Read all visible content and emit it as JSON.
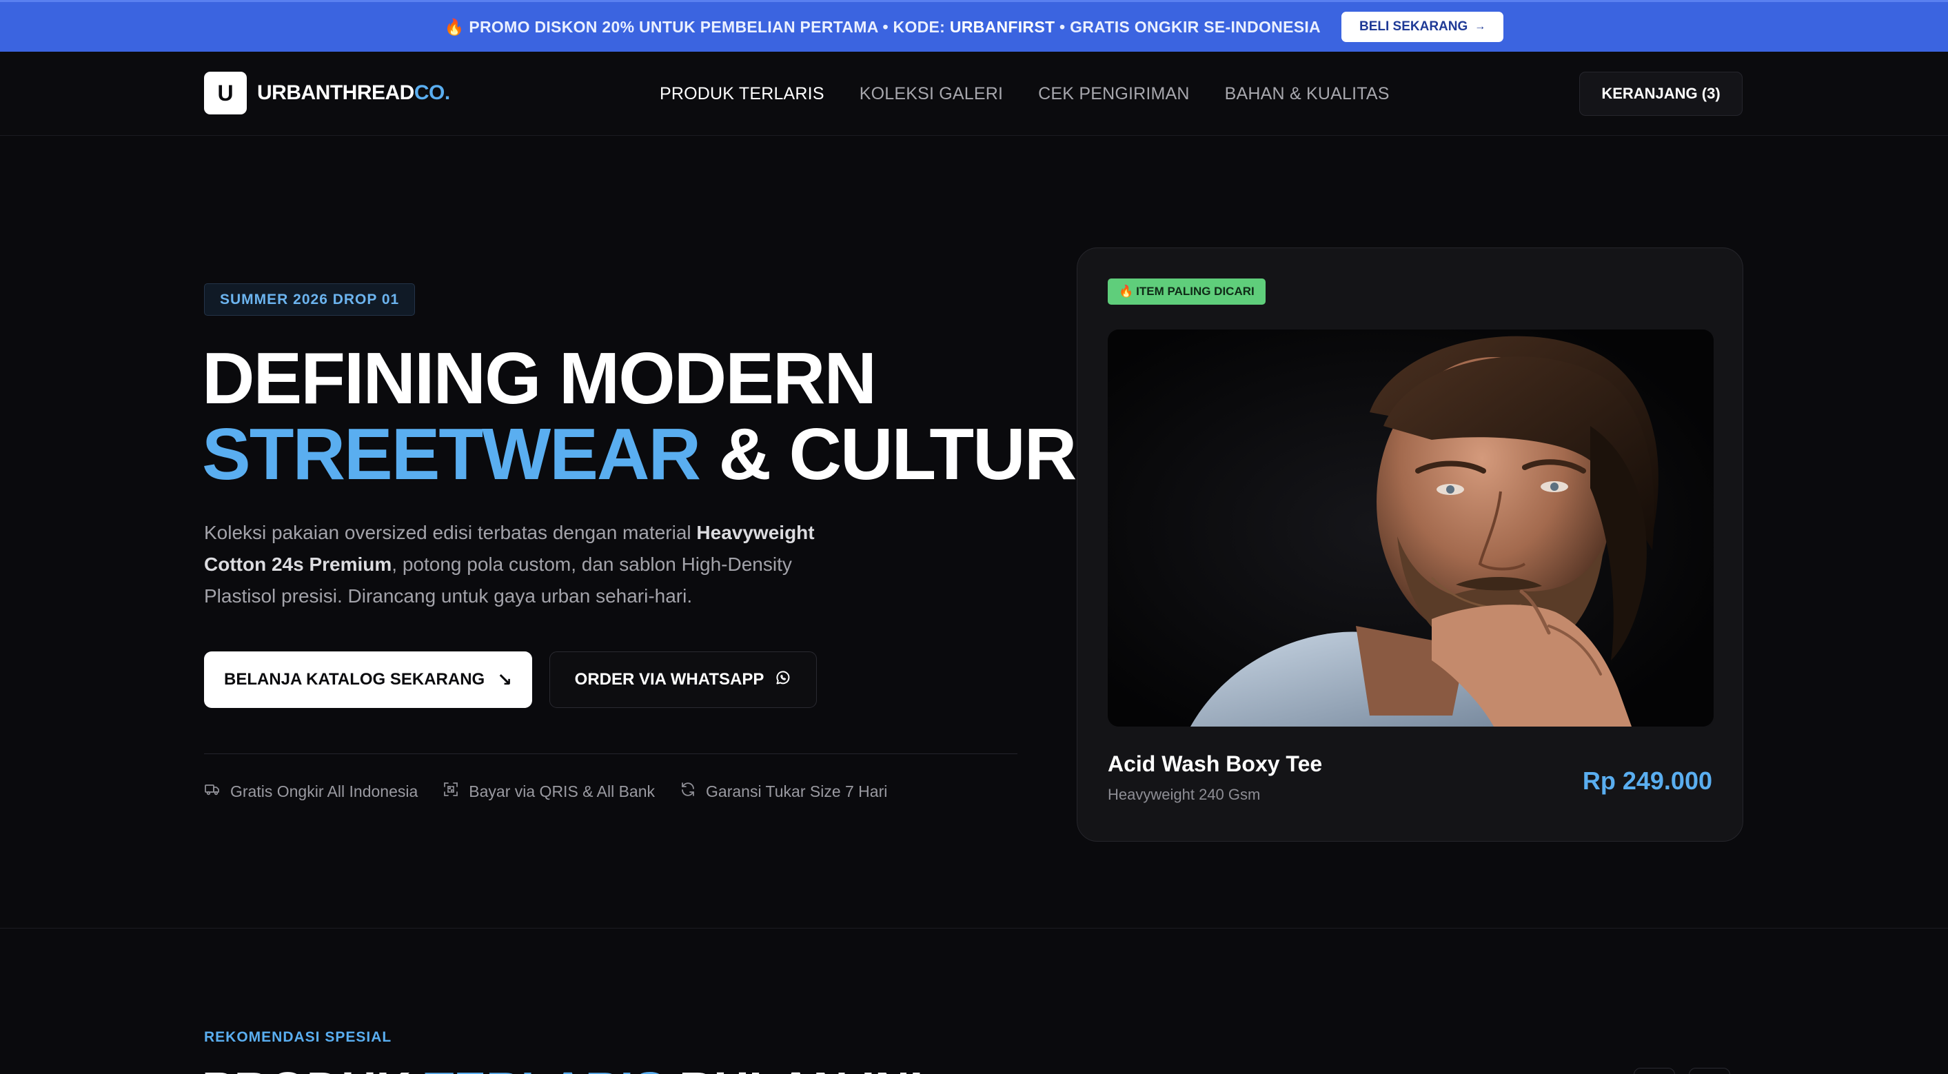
{
  "promo": {
    "emoji": "🔥",
    "text_before": "PROMO DISKON 20% UNTUK PEMBELIAN PERTAMA • KODE: ",
    "code": "URBANFIRST",
    "text_after": " • GRATIS ONGKIR SE-INDONESIA",
    "button_label": "BELI SEKARANG",
    "button_arrow": "→"
  },
  "header": {
    "logo_letter": "U",
    "logo_name": "URBANTHREAD",
    "logo_suffix": "CO.",
    "nav": [
      {
        "label": "PRODUK TERLARIS",
        "active": true
      },
      {
        "label": "KOLEKSI GALERI",
        "active": false
      },
      {
        "label": "CEK PENGIRIMAN",
        "active": false
      },
      {
        "label": "BAHAN & KUALITAS",
        "active": false
      }
    ],
    "cart_label": "KERANJANG (3)"
  },
  "hero": {
    "badge": "SUMMER 2026 DROP 01",
    "headline_line1": "DEFINING MODERN",
    "headline_blue": "STREETWEAR",
    "headline_rest": " & CULTURE.",
    "desc_part1": "Koleksi pakaian oversized edisi terbatas dengan material ",
    "desc_bold": "Heavyweight Cotton 24s Premium",
    "desc_part2": ", potong pola custom, dan sablon High-Density Plastisol presisi. Dirancang untuk gaya urban sehari-hari.",
    "primary_button": "BELANJA KATALOG SEKARANG",
    "primary_arrow": "↘",
    "secondary_button": "ORDER VIA WHATSAPP",
    "features": [
      {
        "icon": "truck-icon",
        "label": "Gratis Ongkir All Indonesia"
      },
      {
        "icon": "qr-code-icon",
        "label": "Bayar via QRIS & All Bank"
      },
      {
        "icon": "refresh-icon",
        "label": "Garansi Tukar Size 7 Hari"
      }
    ]
  },
  "product_card": {
    "badge_emoji": "🔥",
    "badge": "ITEM PALING DICARI",
    "name": "Acid Wash Boxy Tee",
    "subtitle": "Heavyweight 240 Gsm",
    "price": "Rp 249.000"
  },
  "section": {
    "label": "REKOMENDASI SPESIAL",
    "title_part1": "PRODUK ",
    "title_blue": "TERLARIS",
    "title_part2": " BULAN INI"
  },
  "colors": {
    "promo_bg": "#3b64e0",
    "accent_blue": "#5aaef0",
    "hot_badge": "#5fce7b",
    "background": "#0a0a0d"
  }
}
